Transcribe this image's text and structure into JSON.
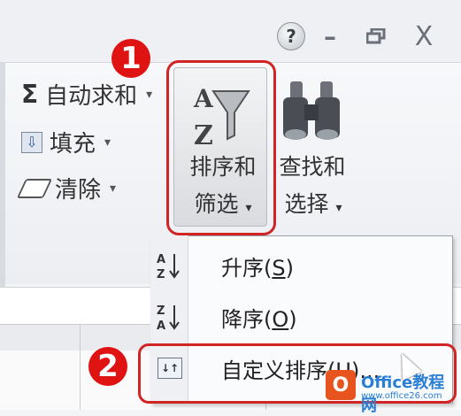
{
  "window_controls": {
    "help": "?",
    "minimize": "–",
    "restore": "❐",
    "close": "X"
  },
  "ribbon": {
    "autosum_label": "自动求和",
    "fill_label": "填充",
    "clear_label": "清除",
    "sort_filter_line1": "排序和",
    "sort_filter_line2": "筛选",
    "find_select_line1": "查找和",
    "find_select_line2": "选择",
    "dropdown_arrow": "▾"
  },
  "sort_menu": {
    "items": [
      {
        "label": "升序",
        "key": "S",
        "icon": "sort-ascending-icon"
      },
      {
        "label": "降序",
        "key": "O",
        "icon": "sort-descending-icon"
      },
      {
        "label": "自定义排序",
        "key": "U",
        "icon": "custom-sort-icon"
      }
    ],
    "ellipsis": "..."
  },
  "annotations": {
    "step1": "1",
    "step2": "2"
  },
  "watermark": {
    "title": "Office教程网",
    "url": "www.office26.com"
  },
  "colors": {
    "annotation_red": "#d12424",
    "watermark_orange": "#e8541e",
    "watermark_blue": "#2a7fd4"
  }
}
